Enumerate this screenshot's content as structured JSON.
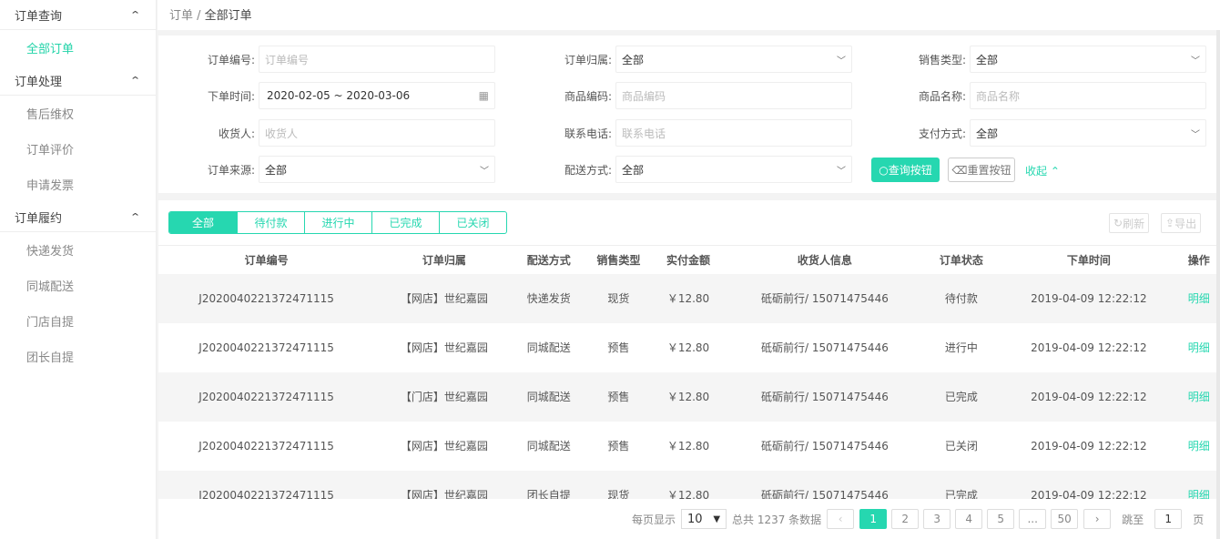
{
  "sidebar": {
    "groups": [
      {
        "label": "订单查询",
        "items": [
          "全部订单"
        ]
      },
      {
        "label": "订单处理",
        "items": [
          "售后维权",
          "订单评价",
          "申请发票"
        ]
      },
      {
        "label": "订单履约",
        "items": [
          "快递发货",
          "同城配送",
          "门店自提",
          "团长自提"
        ]
      }
    ]
  },
  "breadcrumb": {
    "parent": "订单",
    "sep": " / ",
    "current": "全部订单"
  },
  "filters": {
    "order_no": {
      "label": "订单编号:",
      "placeholder": "订单编号"
    },
    "order_time": {
      "label": "下单时间:",
      "value": "2020-02-05 ~ 2020-03-06"
    },
    "receiver": {
      "label": "收货人:",
      "placeholder": "收货人"
    },
    "source": {
      "label": "订单来源:",
      "value": "全部"
    },
    "belong": {
      "label": "订单归属:",
      "value": "全部"
    },
    "product_code": {
      "label": "商品编码:",
      "placeholder": "商品编码"
    },
    "phone": {
      "label": "联系电话:",
      "placeholder": "联系电话"
    },
    "delivery": {
      "label": "配送方式:",
      "value": "全部"
    },
    "sale_type": {
      "label": "销售类型:",
      "value": "全部"
    },
    "product_name": {
      "label": "商品名称:",
      "placeholder": "商品名称"
    },
    "payment": {
      "label": "支付方式:",
      "value": "全部"
    },
    "query_label": "查询按钮",
    "reset_label": "重置按钮",
    "collapse_label": "收起"
  },
  "tabs": [
    "全部",
    "待付款",
    "进行中",
    "已完成",
    "已关闭"
  ],
  "toolbar": {
    "refresh": "刷新",
    "export": "导出"
  },
  "table": {
    "columns": [
      "订单编号",
      "订单归属",
      "配送方式",
      "销售类型",
      "实付金额",
      "收货人信息",
      "订单状态",
      "下单时间",
      "操作"
    ],
    "rows": [
      [
        "J2020040221372471115",
        "【网店】世纪嘉园",
        "快递发货",
        "现货",
        "￥12.80",
        "砥砺前行/ 15071475446",
        "待付款",
        "2019-04-09 12:22:12",
        "明细"
      ],
      [
        "J2020040221372471115",
        "【网店】世纪嘉园",
        "同城配送",
        "预售",
        "￥12.80",
        "砥砺前行/ 15071475446",
        "进行中",
        "2019-04-09 12:22:12",
        "明细"
      ],
      [
        "J2020040221372471115",
        "【门店】世纪嘉园",
        "同城配送",
        "预售",
        "￥12.80",
        "砥砺前行/ 15071475446",
        "已完成",
        "2019-04-09 12:22:12",
        "明细"
      ],
      [
        "J2020040221372471115",
        "【网店】世纪嘉园",
        "同城配送",
        "预售",
        "￥12.80",
        "砥砺前行/ 15071475446",
        "已关闭",
        "2019-04-09 12:22:12",
        "明细"
      ],
      [
        "J2020040221372471115",
        "【网店】世纪嘉园",
        "团长自提",
        "现货",
        "￥12.80",
        "砥砺前行/ 15071475446",
        "已完成",
        "2019-04-09 12:22:12",
        "明细"
      ]
    ]
  },
  "pagination": {
    "per_page_label": "每页显示",
    "per_page": "10",
    "total_text": "总共 1237 条数据",
    "prev": "‹",
    "next": "›",
    "pages": [
      "1",
      "2",
      "3",
      "4",
      "5",
      "...",
      "50"
    ],
    "jump_label": "跳至",
    "jump_value": "1",
    "page_suffix": "页"
  }
}
